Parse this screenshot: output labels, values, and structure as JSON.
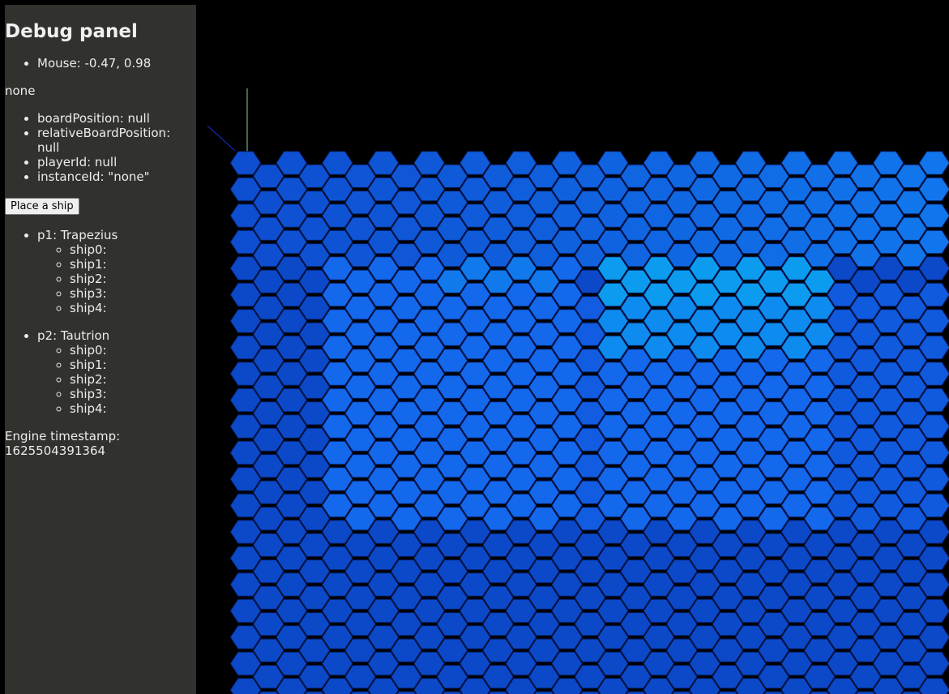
{
  "debug_panel": {
    "title": "Debug panel",
    "mouse": "Mouse: -0.47, 0.98",
    "hover_target": "none",
    "board_info": [
      "boardPosition: null",
      "relativeBoardPosition: null",
      "playerId: null",
      "instanceId: \"none\""
    ],
    "place_ship_label": "Place a ship",
    "players": [
      {
        "label": "p1: Trapezius",
        "ships": [
          "ship0:",
          "ship1:",
          "ship2:",
          "ship3:",
          "ship4:"
        ]
      },
      {
        "label": "p2: Tautrion",
        "ships": [
          "ship0:",
          "ship1:",
          "ship2:",
          "ship3:",
          "ship4:"
        ]
      }
    ],
    "engine_timestamp_label": "Engine timestamp:",
    "engine_timestamp_value": "1625504391364"
  },
  "board": {
    "columns": 31,
    "rows": 21,
    "colors": {
      "edge": "#0a3fbd",
      "mid": "#1365ec",
      "bright": "#0aaaf0",
      "outline": "#061a5a",
      "axis_y": "#7fd27f",
      "axis_x": "#1b2fd6"
    }
  }
}
